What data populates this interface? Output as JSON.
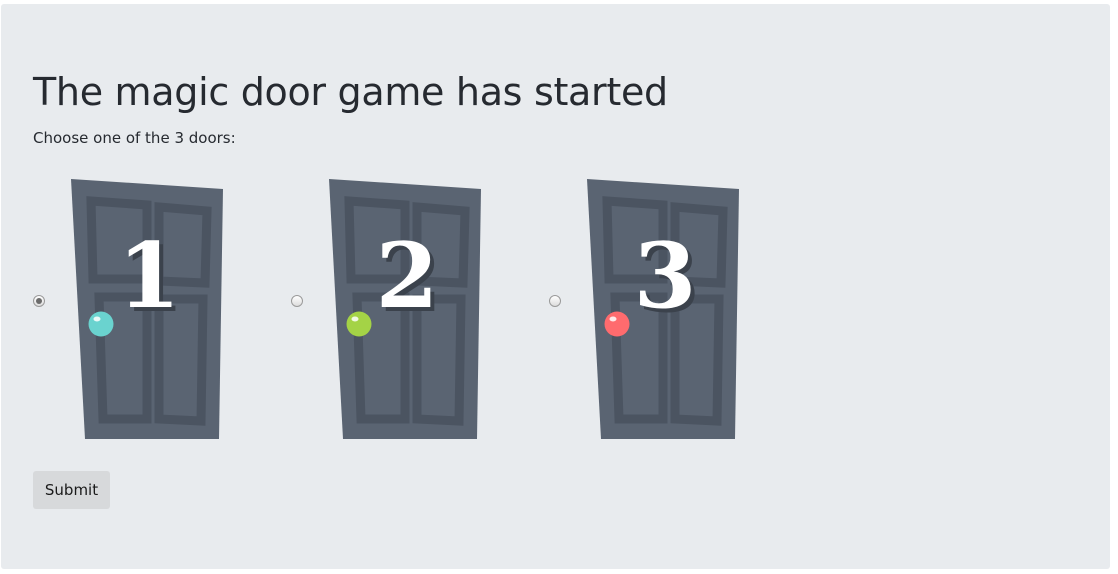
{
  "title": "The magic door game has started",
  "subtitle": "Choose one of the 3 doors:",
  "doors": [
    {
      "number": "1",
      "knob_color": "#6ad3cf",
      "selected": true
    },
    {
      "number": "2",
      "knob_color": "#a4d346",
      "selected": false
    },
    {
      "number": "3",
      "knob_color": "#ff6b6e",
      "selected": false
    }
  ],
  "submit_label": "Submit",
  "colors": {
    "background": "#e8ebee",
    "door": "#5a6472",
    "door_panel": "#4b5461"
  }
}
